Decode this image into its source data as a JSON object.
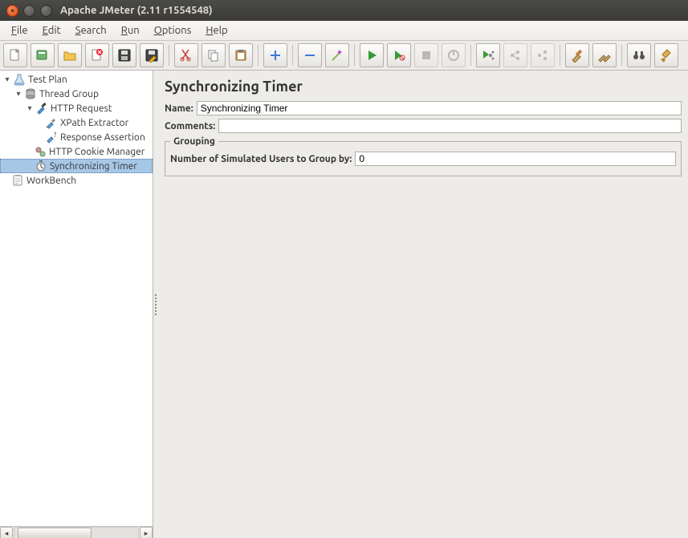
{
  "window": {
    "title": "Apache JMeter (2.11 r1554548)"
  },
  "menus": {
    "file": "File",
    "edit": "Edit",
    "search": "Search",
    "run": "Run",
    "options": "Options",
    "help": "Help"
  },
  "toolbar_icons": {
    "new": "new-file-icon",
    "templates": "templates-icon",
    "open": "open-folder-icon",
    "close": "close-file-icon",
    "save": "save-icon",
    "save_as": "save-as-icon",
    "cut": "cut-icon",
    "copy": "copy-icon",
    "paste": "paste-icon",
    "expand": "plus-icon",
    "collapse": "minus-icon",
    "toggle": "wand-icon",
    "start": "play-icon",
    "start_no_timers": "play-no-timers-icon",
    "stop": "stop-icon",
    "shutdown": "shutdown-icon",
    "remote_start": "remote-start-icon",
    "remote_stop": "remote-stop-icon",
    "remote_shutdown": "remote-shutdown-icon",
    "clear": "clear-icon",
    "clear_all": "clear-all-icon",
    "search_tree": "binoculars-icon",
    "reset_search": "broom-icon"
  },
  "tree": {
    "test_plan": "Test Plan",
    "thread_group": "Thread Group",
    "http_request": "HTTP Request",
    "xpath_extractor": "XPath Extractor",
    "response_assertion": "Response Assertion",
    "http_cookie_manager": "HTTP Cookie Manager",
    "sync_timer": "Synchronizing Timer",
    "workbench": "WorkBench"
  },
  "panel": {
    "title": "Synchronizing Timer",
    "name_label": "Name:",
    "name_value": "Synchronizing Timer",
    "comments_label": "Comments:",
    "comments_value": "",
    "grouping_legend": "Grouping",
    "users_label": "Number of Simulated Users to Group by:",
    "users_value": "0"
  }
}
